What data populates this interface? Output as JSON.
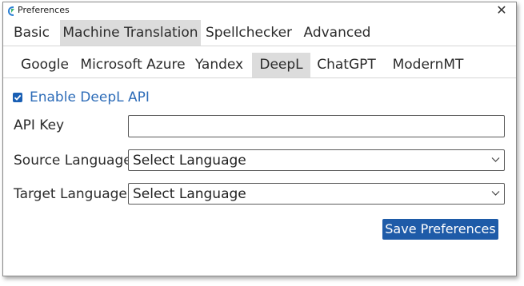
{
  "window": {
    "title": "Preferences",
    "app_icon": "app-icon",
    "close_icon": "close-icon",
    "close_glyph": "✕"
  },
  "main_tabs": [
    {
      "label": "Basic",
      "active": false
    },
    {
      "label": "Machine Translation",
      "active": true
    },
    {
      "label": "Spellchecker",
      "active": false
    },
    {
      "label": "Advanced",
      "active": false
    }
  ],
  "sub_tabs": [
    {
      "label": "Google",
      "active": false
    },
    {
      "label": "Microsoft Azure",
      "active": false
    },
    {
      "label": "Yandex",
      "active": false
    },
    {
      "label": "DeepL",
      "active": true
    },
    {
      "label": "ChatGPT",
      "active": false
    },
    {
      "label": "ModernMT",
      "active": false
    }
  ],
  "deepl": {
    "enable_label": "Enable DeepL API",
    "enabled": true,
    "api_key_label": "API Key",
    "api_key_value": "",
    "source_language_label": "Source Language",
    "source_language_value": "Select Language",
    "target_language_label": "Target Language",
    "target_language_value": "Select Language",
    "save_label": "Save Preferences"
  },
  "colors": {
    "accent": "#1e5ba8",
    "link_text": "#2d6cb8",
    "active_tab_bg": "#dcdcdc"
  }
}
